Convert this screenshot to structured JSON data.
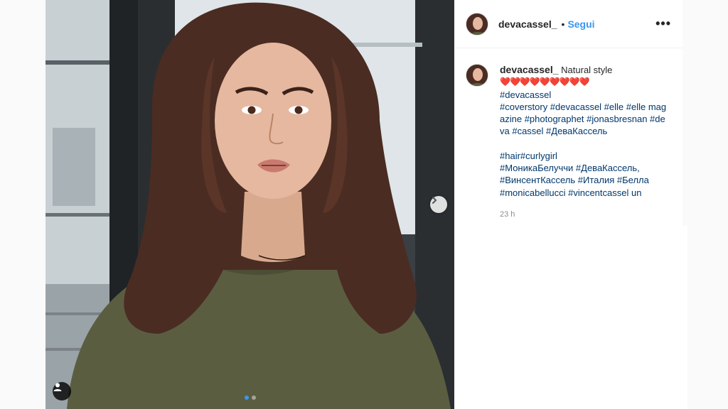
{
  "post": {
    "username": "devacassel_",
    "separator": "•",
    "follow_label": "Segui",
    "more_label": "•••",
    "caption": {
      "text": "Natural style",
      "hearts": "❤️❤️❤️❤️❤️❤️❤️❤️❤️",
      "lines": [
        "#devacassel",
        "#coverstory #devacassel #elle #elle magazine #photographet #jonasbresnan #deva #cassel #ДеваКассель",
        "",
        "#hair#curlygirl",
        "#МоникаБелуччи #ДеваКассель,",
        "#ВинсентКассель #Италия #Белла",
        "#monicabellucci #vincentcassel un"
      ]
    },
    "timestamp": "23 h"
  },
  "carousel": {
    "slide_count": 2,
    "active_index": 0,
    "next_icon": "chevron-right-icon",
    "tag_icon": "user-tag-icon",
    "accent": "#3897f0"
  },
  "colors": {
    "link": "#00376b",
    "follow": "#3897f0",
    "muted": "#8e8e8e"
  }
}
